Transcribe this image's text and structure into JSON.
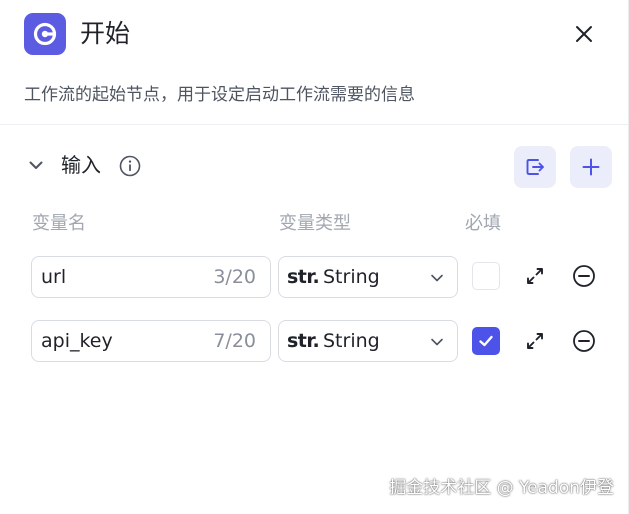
{
  "header": {
    "title": "开始",
    "node_icon": "start-node-icon",
    "close_icon": "close-icon",
    "accent_color": "#5b5ce2"
  },
  "description": "工作流的起始节点，用于设定启动工作流需要的信息",
  "inputs_section": {
    "title": "输入",
    "expanded": true,
    "actions": [
      {
        "icon": "import-icon"
      },
      {
        "icon": "add-icon"
      }
    ],
    "columns": [
      "变量名",
      "变量类型",
      "必填"
    ],
    "rows": [
      {
        "name": "url",
        "count": "3/20",
        "type_prefix": "str.",
        "type": "String",
        "required": false
      },
      {
        "name": "api_key",
        "count": "7/20",
        "type_prefix": "str.",
        "type": "String",
        "required": true
      }
    ]
  },
  "watermark": "掘金技术社区 @ Yeadon伊登"
}
